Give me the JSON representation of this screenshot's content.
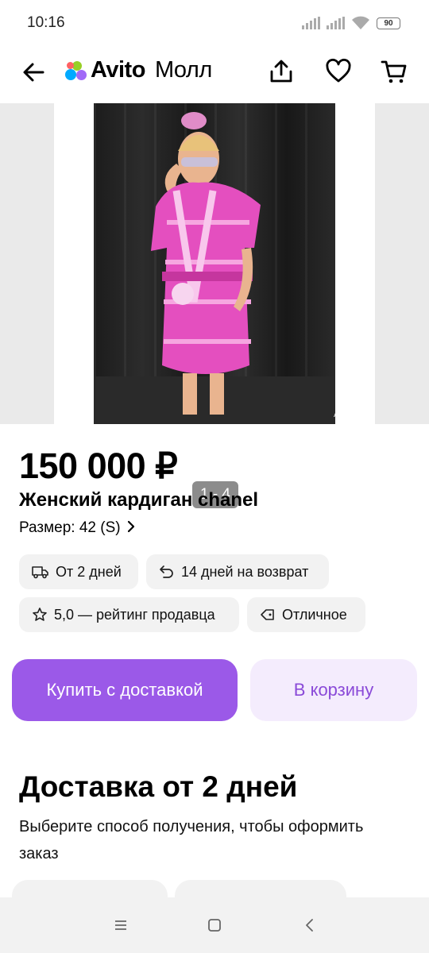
{
  "status": {
    "time": "10:16",
    "battery": "90"
  },
  "header": {
    "brand": "Avito",
    "sub": "Молл"
  },
  "gallery": {
    "counter": "1 - 4",
    "watermark": "Avito"
  },
  "product": {
    "price": "150 000 ₽",
    "title": "Женский кардиган chanel",
    "size": "Размер: 42 (S)"
  },
  "chips": {
    "delivery": "От 2 дней",
    "return": "14 дней на возврат",
    "rating": "5,0 — рейтинг продавца",
    "condition": "Отличное"
  },
  "actions": {
    "buy": "Купить с доставкой",
    "cart": "В корзину"
  },
  "delivery": {
    "title": "Доставка от 2 дней",
    "subtitle": "Выберите способ получения, чтобы оформить заказ"
  },
  "colors": {
    "accent": "#9b59e8",
    "accent_light": "#f4ecfd",
    "chip_bg": "#f2f2f2"
  }
}
